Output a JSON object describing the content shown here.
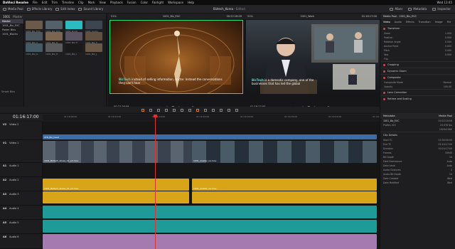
{
  "menubar": {
    "app": "DaVinci Resolve",
    "items": [
      "File",
      "Edit",
      "Trim",
      "Timeline",
      "Clip",
      "Mark",
      "View",
      "Playback",
      "Fusion",
      "Color",
      "Fairlight",
      "Workspace",
      "Help"
    ],
    "right": "Wed 13:45"
  },
  "toolbar": {
    "media_pool": "Media Pool",
    "effects": "Effects Library",
    "edit_index": "Edit Index",
    "sound_library": "Sound Library",
    "project": "Biztech_Korea",
    "edited": "Edited",
    "mixer": "Mixer",
    "metadata": "Metadata",
    "inspector": "Inspector"
  },
  "pool": {
    "header": "1001",
    "zoom": "Master",
    "bins": [
      "Master",
      "1001_Biz_EVC",
      "Power Bins",
      "1001_Blocks"
    ],
    "smart_bins": "Smart Bins",
    "selected_bin": "Master"
  },
  "thumbs": [
    {
      "label": "1001_Biz_EVC",
      "color": "#6b5a4a"
    },
    {
      "label": "1001_Biz_EVC",
      "color": "#54606a"
    },
    {
      "label": "1001_B-roll",
      "color": "#2bbcc0"
    },
    {
      "label": "1001_Audio",
      "color": "#3b4650"
    },
    {
      "label": "1001_Biz_C",
      "color": "#4c5660"
    },
    {
      "label": "1001_Biz_D",
      "color": "#7a6650"
    },
    {
      "label": "1001_Biz_E",
      "color": "#5a5260"
    },
    {
      "label": "1001_Biz_F",
      "color": "#605040"
    },
    {
      "label": "1001_Biz_G",
      "color": "#445a66"
    },
    {
      "label": "1001_Biz_H",
      "color": "#5a5a5a"
    },
    {
      "label": "1001_Biz_I",
      "color": "#1a1a1a"
    },
    {
      "label": "1001_Biz_J",
      "color": "#6a5846"
    }
  ],
  "viewer_src": {
    "zoom": "51%",
    "timecode_top": "00:22:16:09",
    "clip": "1001_Biz_EVC",
    "sub_brand": "BizTech",
    "sub_text": "instead of selling information, sector. Instead the conversations they can't hear",
    "tc": "00:22:16:09"
  },
  "viewer_pgm": {
    "zoom": "51%",
    "timecode_top": "01:16:17:00",
    "timeline": "1001_Work",
    "tc": "01:16:17:00",
    "sub_brand": "BizTech",
    "sub_text": "is a domestic company, one of the businesses that has led the global"
  },
  "inspector": {
    "title": "Media Pool - 1001_Biz_EVC",
    "tabs": [
      "Video",
      "Audio",
      "Effects",
      "Transition",
      "Image",
      "File"
    ],
    "sections": [
      "Transform",
      "Cropping",
      "Dynamic Zoom",
      "Composite",
      "Lens Correction",
      "Retime and Scaling"
    ],
    "rows": [
      [
        "Zoom",
        "1.000"
      ],
      [
        "Position",
        "0.000"
      ],
      [
        "Rotation Angle",
        "0.000"
      ],
      [
        "Anchor Point",
        "0.000"
      ],
      [
        "Pitch",
        "0.000"
      ],
      [
        "Yaw",
        "0.000"
      ],
      [
        "Flip",
        ""
      ]
    ],
    "composite_mode": "Normal",
    "opacity": "100.00"
  },
  "timeline": {
    "timecode": "01:16:17:00",
    "ticks": [
      "01:16:06:00",
      "01:16:12:00",
      "01:16:18:00",
      "01:16:24:00",
      "01:16:30:00",
      "01:16:36:00",
      "01:16:42:00",
      "01:16:48:00"
    ]
  },
  "tracks": [
    {
      "id": "V2",
      "name": "Video 2"
    },
    {
      "id": "V1",
      "name": "Video 1"
    },
    {
      "id": "A1",
      "name": "Audio 1"
    },
    {
      "id": "A2",
      "name": "Audio 2"
    },
    {
      "id": "A3",
      "name": "Audio 3"
    },
    {
      "id": "A4",
      "name": "Audio 4"
    },
    {
      "id": "A5",
      "name": "Audio 5"
    },
    {
      "id": "A6",
      "name": "Audio 6"
    }
  ],
  "clips": {
    "v2_a": "ATN_Biz_head",
    "v1_a": "1001_Biztech_Korea_01_ad.mov",
    "v1_b": "1001_master_ne.mov",
    "a1": "1001_Biztech_Korea_01_ad.mov",
    "a1_b": "1001_master_ne.mov"
  },
  "metadata": {
    "title": "Metadata",
    "tab": "Media Pool",
    "clip": "1001_Biz_EVC",
    "date": "00:22:16:09",
    "fps": "23.976 fps",
    "res": "1920x1080",
    "codec": "ProRes 422",
    "rows": [
      [
        "Start TC",
        "01:00:00:00"
      ],
      [
        "End TC",
        "01:24:17:00"
      ],
      [
        "Duration",
        "00:24:17:00"
      ],
      [
        "Frames",
        "34945"
      ],
      [
        "Bit Depth",
        "10"
      ],
      [
        "Field Dominance",
        "Auto"
      ],
      [
        "Data Level",
        "Auto"
      ],
      [
        "Audio Channels",
        "2"
      ],
      [
        "Audio Bit Depth",
        "24"
      ],
      [
        "Date Created",
        "Wed"
      ],
      [
        "Date Modified",
        "Wed"
      ]
    ],
    "clip_details": "Clip Details"
  }
}
